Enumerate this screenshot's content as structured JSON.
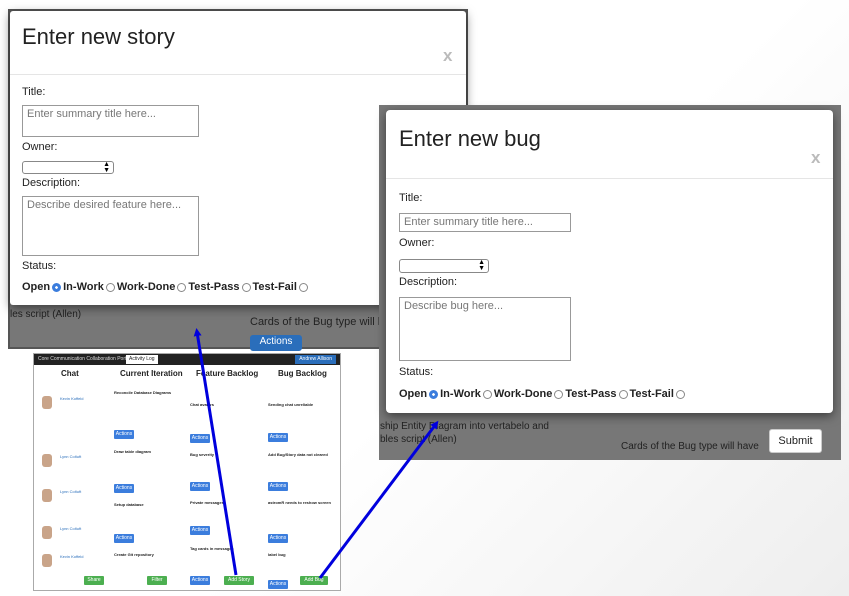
{
  "story_modal": {
    "title": "Enter new story",
    "close": "x",
    "title_label": "Title:",
    "title_placeholder": "Enter summary title here...",
    "owner_label": "Owner:",
    "description_label": "Description:",
    "description_placeholder": "Describe desired feature here...",
    "status_label": "Status:",
    "statuses": [
      "Open",
      "In-Work",
      "Work-Done",
      "Test-Pass",
      "Test-Fail"
    ],
    "selected_status": "In-Work",
    "bg_text": "les script (Allen)"
  },
  "bug_modal": {
    "title": "Enter new bug",
    "close": "x",
    "title_label": "Title:",
    "title_placeholder": "Enter summary title here...",
    "owner_label": "Owner:",
    "description_label": "Description:",
    "description_placeholder": "Describe bug here...",
    "status_label": "Status:",
    "statuses": [
      "Open",
      "In-Work",
      "Work-Done",
      "Test-Pass",
      "Test-Fail"
    ],
    "selected_status": "In-Work",
    "submit": "Submit"
  },
  "background": {
    "cards_text": "Cards of the Bug type will h",
    "actions_label": "Actions",
    "cards_text_2": "Cards of the Bug type will have",
    "entity_line1": "ship Entity Diagram into vertabelo and",
    "entity_line2": "bles script (Allen)"
  },
  "mini_app": {
    "brand": "Core Communication Collaboration Portal",
    "tab": "Activity Log",
    "user": "Andrew Allison",
    "columns": [
      "Chat",
      "Current Iteration",
      "Feature Backlog",
      "Bug Backlog"
    ],
    "buttons": {
      "share": "Share",
      "filter": "Filter",
      "add_story": "Add Story",
      "add_bug": "Add Bug",
      "actions": "Actions"
    },
    "chat_names": [
      "Kevin Koffeld",
      "Lynn Coltuft",
      "Lynn Coltuft",
      "Lynn Coltuft",
      "Kevin Koffeld"
    ],
    "iteration_items": [
      "Reconcile Database Diagrams",
      "Draw table diagram",
      "Setup database",
      "Create Git repository"
    ],
    "feature_items": [
      "Chat avatars",
      "Bug severity",
      "Private messages",
      "Tag cards in messages"
    ],
    "bug_items": [
      "Sending chat unreliable",
      "Add Bug/Story data not cleared",
      "astromR needs to reshow screen",
      "label bug"
    ]
  }
}
